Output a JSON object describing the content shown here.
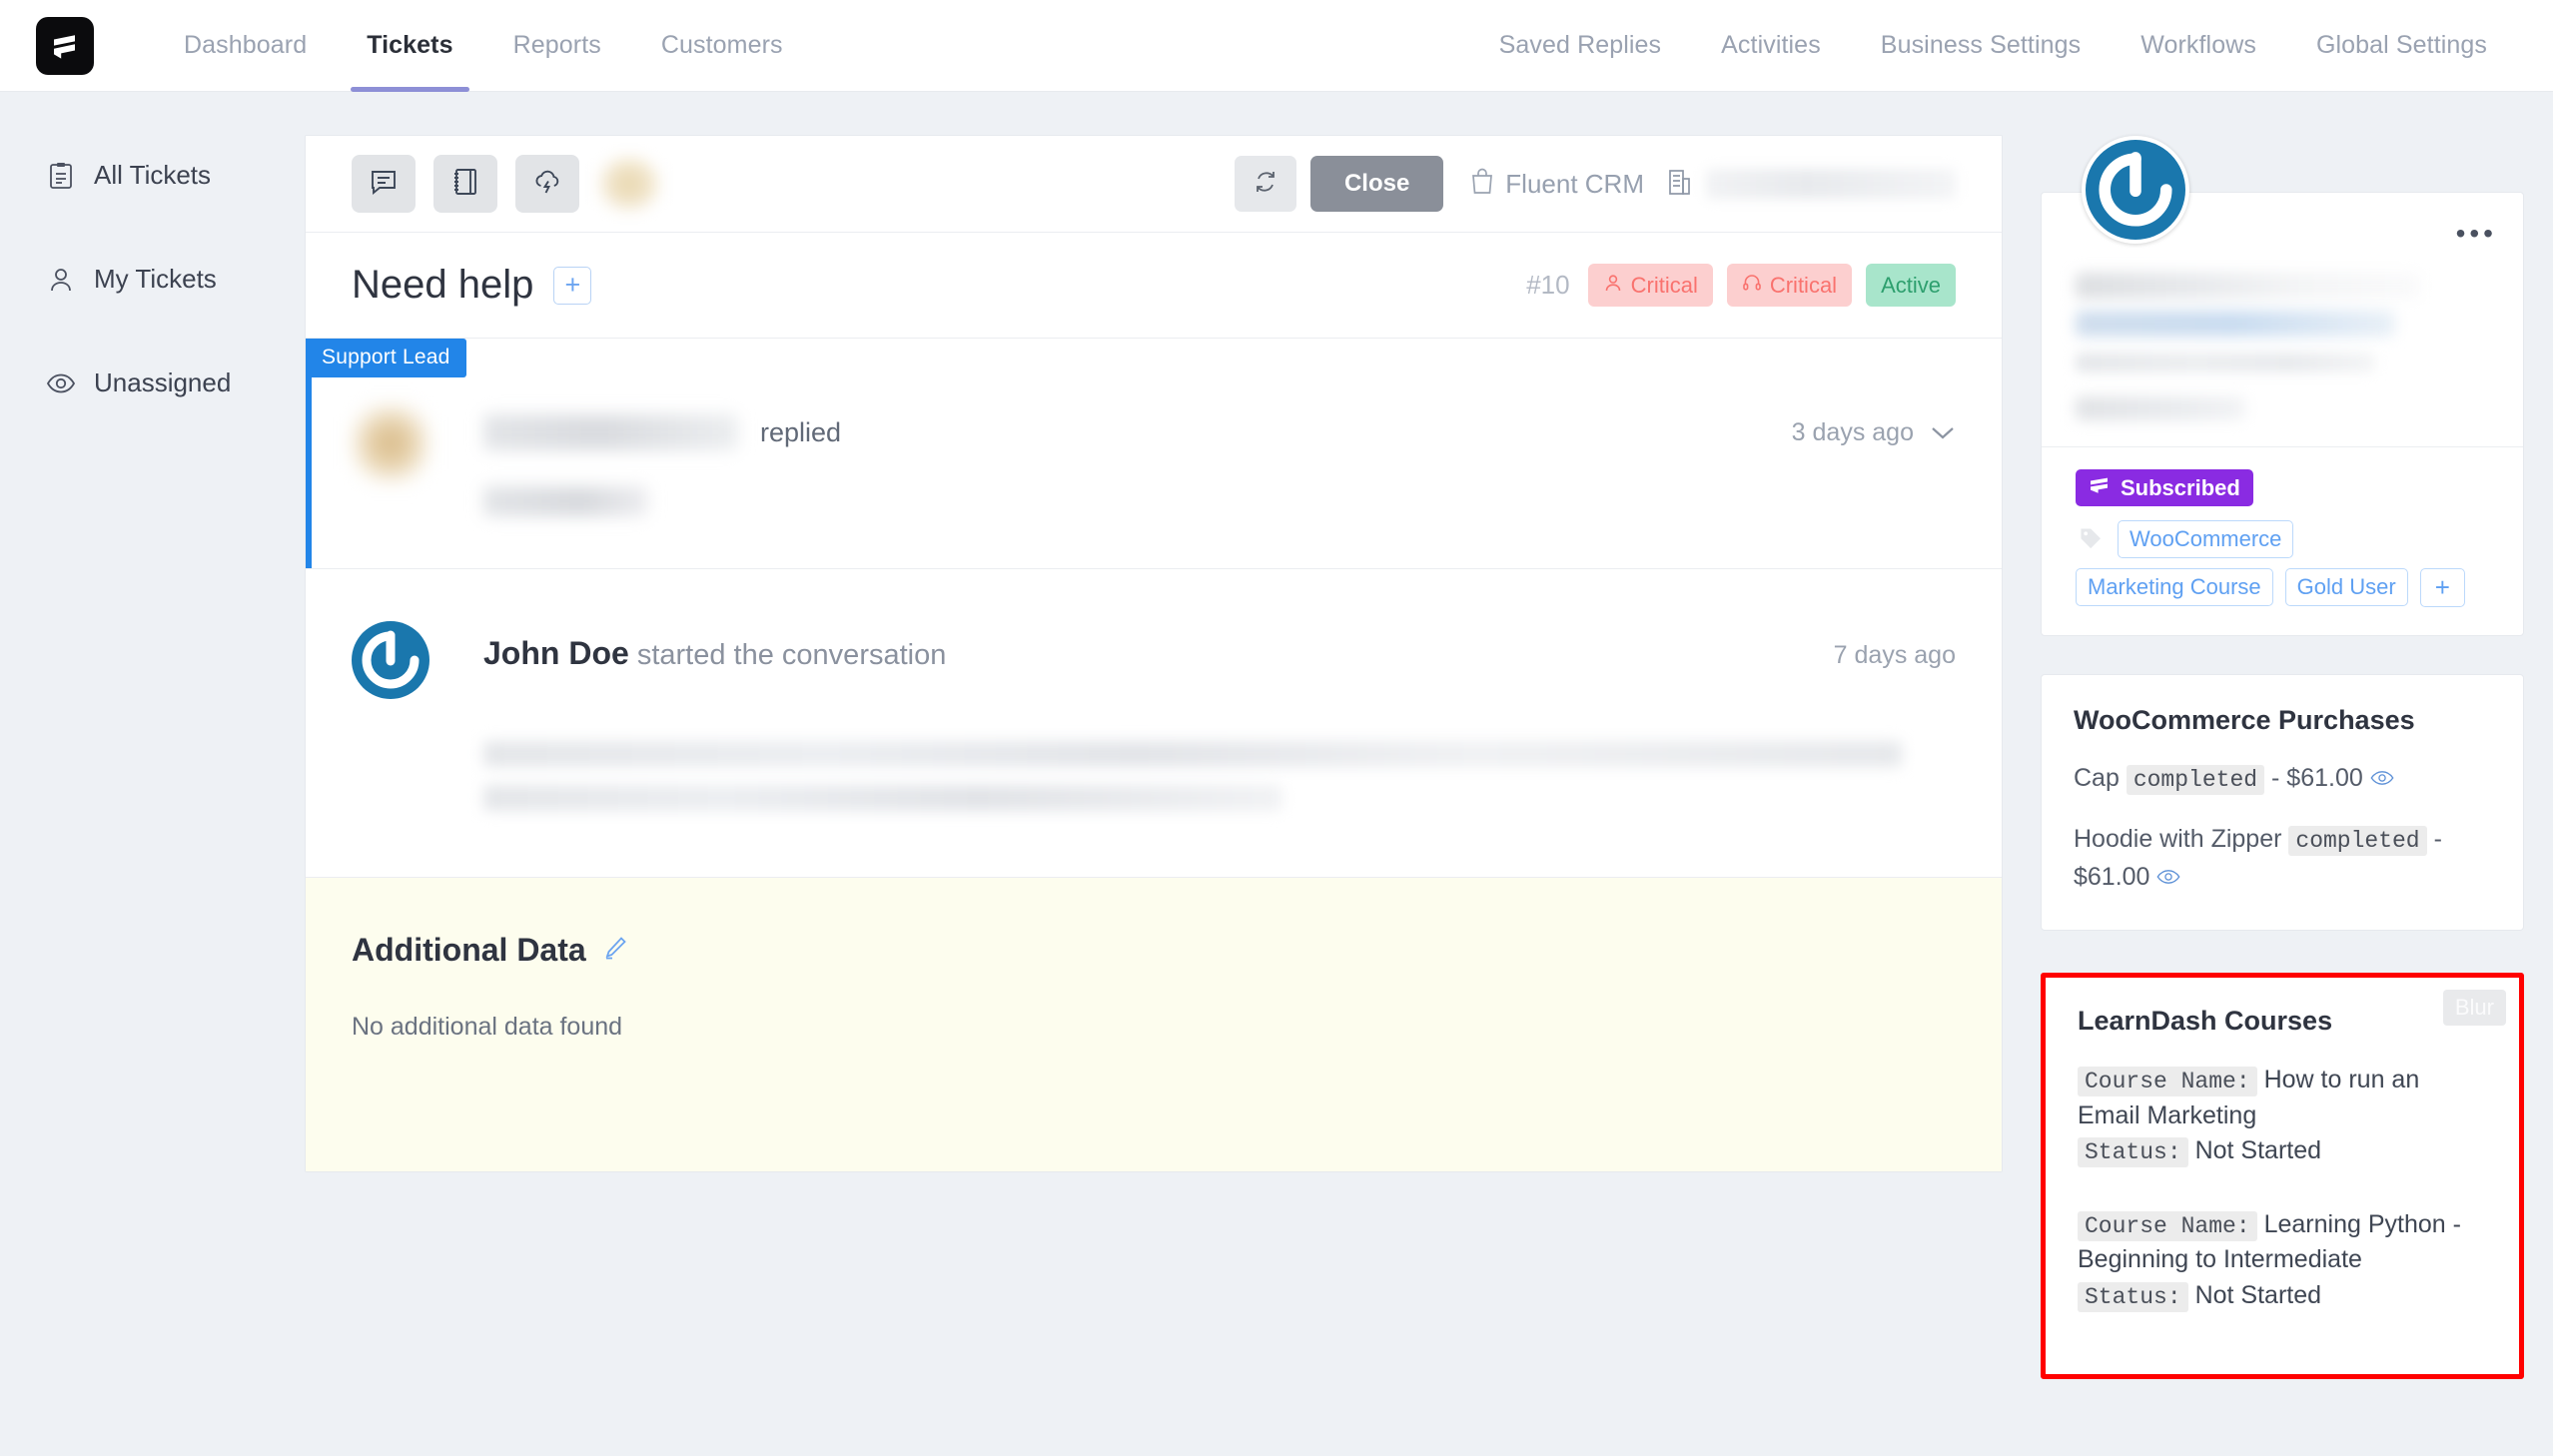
{
  "app": {
    "logo_icon": "fluent-support-logo-icon"
  },
  "topnav": {
    "left_items": [
      {
        "label": "Dashboard",
        "active": false
      },
      {
        "label": "Tickets",
        "active": true
      },
      {
        "label": "Reports",
        "active": false
      },
      {
        "label": "Customers",
        "active": false
      }
    ],
    "right_items": [
      {
        "label": "Saved Replies"
      },
      {
        "label": "Activities"
      },
      {
        "label": "Business Settings"
      },
      {
        "label": "Workflows"
      },
      {
        "label": "Global Settings"
      }
    ]
  },
  "sidebar": {
    "items": [
      {
        "label": "All Tickets",
        "icon": "clipboard-list-icon"
      },
      {
        "label": "My Tickets",
        "icon": "user-icon"
      },
      {
        "label": "Unassigned",
        "icon": "eye-icon"
      }
    ]
  },
  "toolbar": {
    "buttons": [
      {
        "icon": "chat-bubble-icon",
        "name": "reply-button"
      },
      {
        "icon": "notebook-icon",
        "name": "note-button"
      },
      {
        "icon": "cloud-lightning-icon",
        "name": "automation-button"
      }
    ],
    "avatar_redacted": true,
    "refresh_icon": "refresh-icon",
    "close_label": "Close",
    "crm_label": "Fluent CRM",
    "crm_icon": "bag-icon",
    "business_icon": "building-icon",
    "business_name_redacted": true
  },
  "ticket": {
    "title": "Need help",
    "add_label": "+",
    "number": "#10",
    "badges": [
      {
        "label": "Critical",
        "type": "critical",
        "icon": "user-icon"
      },
      {
        "label": "Critical",
        "type": "critical",
        "icon": "headset-icon"
      },
      {
        "label": "Active",
        "type": "active",
        "icon": ""
      }
    ]
  },
  "conversation": {
    "reply": {
      "lead_tag": "Support Lead",
      "author_redacted": true,
      "action": "replied",
      "time": "3 days ago",
      "chevron_icon": "chevron-down-icon",
      "body_redacted": true
    },
    "started": {
      "author": "John Doe",
      "action": "started the conversation",
      "time": "7 days ago",
      "avatar_icon": "gravatar-power-icon",
      "body_redacted": true
    }
  },
  "additional_data": {
    "title": "Additional Data",
    "edit_icon": "pencil-icon",
    "empty_text": "No additional data found"
  },
  "contact": {
    "avatar_icon": "gravatar-power-icon",
    "menu_icon": "ellipsis-icon",
    "details_redacted": true,
    "subscription_badge": "Subscribed",
    "subscription_icon": "fluentcrm-icon",
    "tag_icon": "tag-icon",
    "tags": [
      "WooCommerce",
      "Marketing Course",
      "Gold User"
    ],
    "add_tag_label": "+"
  },
  "woocommerce": {
    "title": "WooCommerce Purchases",
    "purchases": [
      {
        "name": "Cap",
        "status": "completed",
        "separator": "-",
        "price": "$61.00",
        "eye_icon": "eye-icon"
      },
      {
        "name": "Hoodie with Zipper",
        "status": "completed",
        "separator": "-",
        "price": "$61.00",
        "eye_icon": "eye-icon"
      }
    ]
  },
  "learndash": {
    "title": "LearnDash Courses",
    "blur_badge": "Blur",
    "course_label": "Course Name:",
    "status_label": "Status:",
    "courses": [
      {
        "name": "How to run an Email Marketing",
        "status": "Not Started"
      },
      {
        "name": "Learning Python - Beginning to Intermediate",
        "status": "Not Started"
      }
    ]
  }
}
